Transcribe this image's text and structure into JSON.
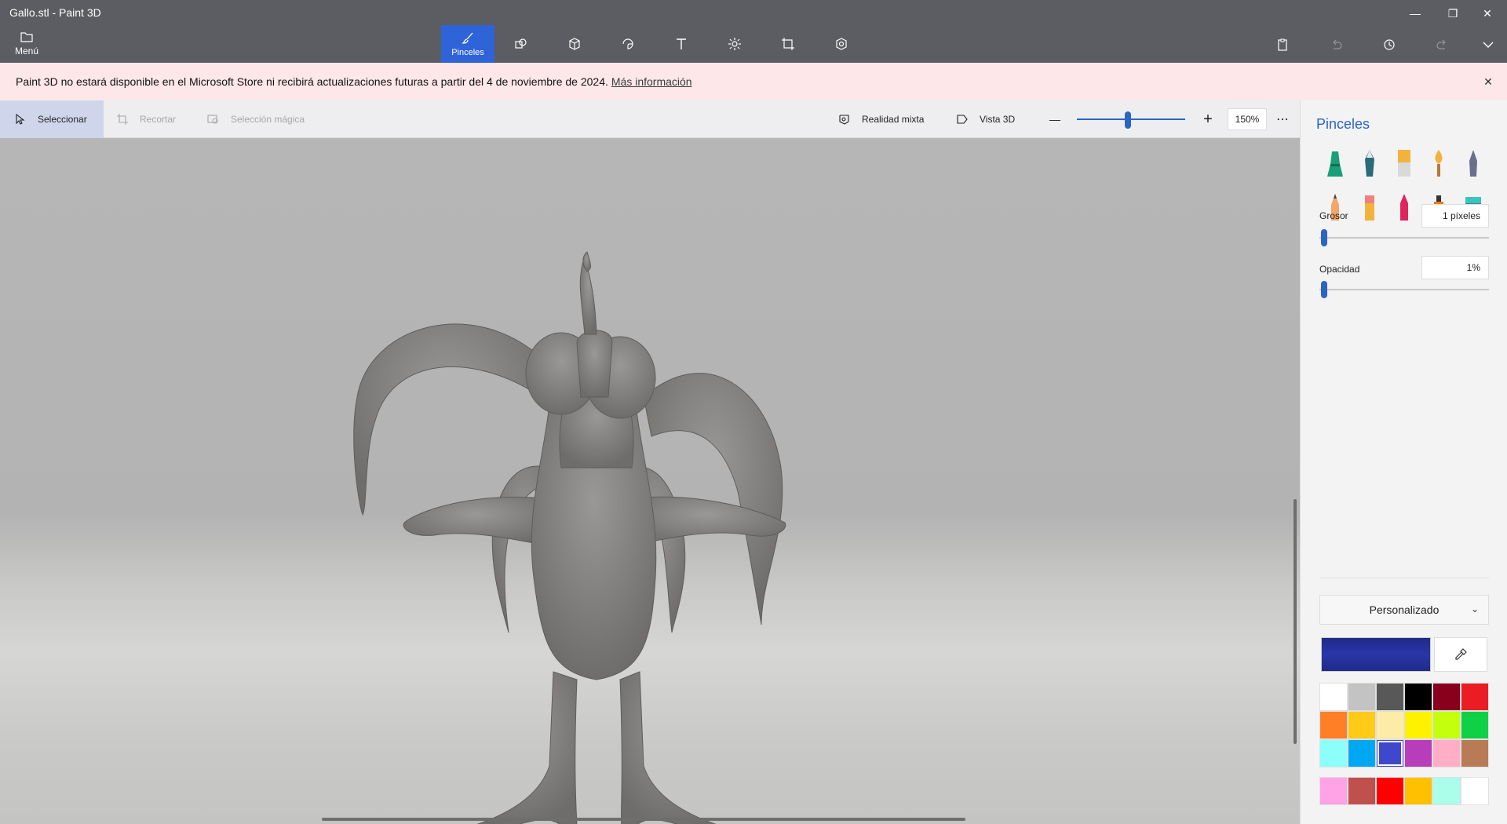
{
  "window": {
    "title": "Gallo.stl - Paint 3D",
    "controls": {
      "minimize": "—",
      "restore": "❐",
      "close": "✕"
    }
  },
  "ribbon": {
    "menu_label": "Menú",
    "active_tool_label": "Pinceles",
    "tools": [
      "brushes",
      "2d-shapes",
      "3d-shapes",
      "stickers",
      "text",
      "effects",
      "canvas",
      "3d-library"
    ]
  },
  "notice": {
    "text": "Paint 3D no estará disponible en el Microsoft Store ni recibirá actualizaciones futuras a partir del 4 de noviembre de 2024.",
    "link": "Más información",
    "close": "✕"
  },
  "commandbar": {
    "select": "Seleccionar",
    "crop": "Recortar",
    "magic_select": "Selección mágica",
    "mixed_reality": "Realidad mixta",
    "view_3d": "Vista 3D",
    "zoom_out": "—",
    "zoom_in": "+",
    "zoom_value": "150%",
    "zoom_level_fraction": 0.47,
    "more": "⋯"
  },
  "panel": {
    "title": "Pinceles",
    "brushes_row1": [
      "marker",
      "calligraphy-pen",
      "oil-brush",
      "watercolor",
      "pixel-pen"
    ],
    "brushes_row2": [
      "pencil",
      "eraser",
      "crayon",
      "spray-can",
      "fill"
    ],
    "thickness_label": "Grosor",
    "thickness_value": "1 píxeles",
    "thickness_fraction": 0.01,
    "opacity_label": "Opacidad",
    "opacity_value": "1%",
    "opacity_fraction": 0.01,
    "palette_selector": "Personalizado",
    "current_color": "#1f2a88",
    "swatches": [
      "#ffffff",
      "#c3c3c3",
      "#585858",
      "#000000",
      "#88001b",
      "#ec1c24",
      "#ff7f27",
      "#ffca18",
      "#fdeca6",
      "#fff200",
      "#c4ff0e",
      "#0ed145",
      "#8cfffb",
      "#00a8f3",
      "#3f48cc",
      "#b83dba",
      "#ffaec8",
      "#b97a56"
    ],
    "selected_swatch": 14,
    "custom_swatches": [
      "#ffa3e6",
      "#c0504d",
      "#ff0000",
      "#ffc000",
      "#a9ffe9",
      "#ffffff"
    ]
  },
  "colors": {
    "accent": "#2a64c5",
    "ribbon": "#5c5d62",
    "notice_bg": "#fde7e9"
  }
}
